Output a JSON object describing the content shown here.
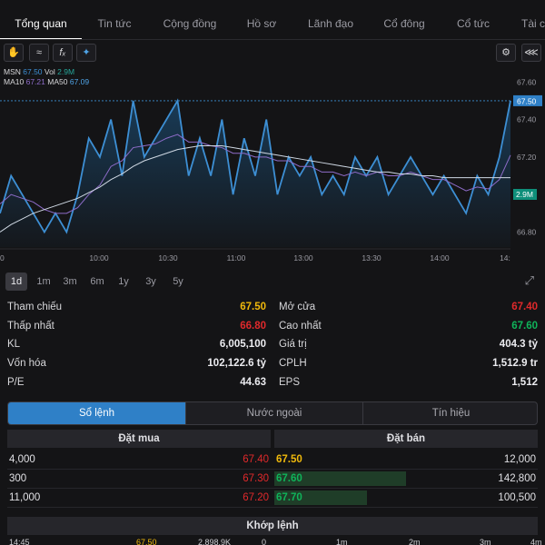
{
  "tabs": [
    "Tổng quan",
    "Tin tức",
    "Cộng đồng",
    "Hồ sơ",
    "Lãnh đạo",
    "Cổ đông",
    "Cổ tức",
    "Tài c"
  ],
  "toolbar": {
    "left_icons": [
      "hand-icon",
      "candle-chart-icon",
      "fx-icon",
      "magic-icon"
    ],
    "right_icons": [
      "gear-icon",
      "share-icon"
    ]
  },
  "legend": {
    "line1": {
      "symbol": "MSN",
      "price": "67.50",
      "vol_label": "Vol",
      "vol": "2.9M"
    },
    "line2": {
      "ma10_label": "MA10",
      "ma10": "67.21",
      "ma50_label": "MA50",
      "ma50": "67.09"
    }
  },
  "chart_data": {
    "type": "line",
    "x": [
      "9:15",
      "9:20",
      "9:25",
      "9:30",
      "9:35",
      "9:40",
      "9:45",
      "9:50",
      "9:55",
      "10:00",
      "10:05",
      "10:10",
      "10:15",
      "10:20",
      "10:25",
      "10:30",
      "10:35",
      "10:40",
      "10:45",
      "10:50",
      "10:55",
      "11:00",
      "11:05",
      "11:10",
      "11:15",
      "11:20",
      "11:25",
      "11:30",
      "13:00",
      "13:05",
      "13:10",
      "13:15",
      "13:20",
      "13:25",
      "13:30",
      "13:35",
      "13:40",
      "13:45",
      "13:50",
      "13:55",
      "14:00",
      "14:05",
      "14:10",
      "14:15",
      "14:20",
      "14:25",
      "14:30"
    ],
    "series": [
      {
        "name": "MSN",
        "values": [
          66.9,
          67.1,
          67.0,
          66.9,
          66.8,
          66.9,
          66.8,
          67.0,
          67.3,
          67.2,
          67.4,
          67.1,
          67.5,
          67.2,
          67.3,
          67.4,
          67.5,
          67.1,
          67.3,
          67.1,
          67.4,
          67.0,
          67.3,
          67.1,
          67.4,
          67.0,
          67.2,
          67.1,
          67.2,
          67.0,
          67.1,
          67.0,
          67.2,
          67.1,
          67.2,
          67.0,
          67.1,
          67.2,
          67.1,
          67.0,
          67.1,
          67.0,
          66.9,
          67.1,
          67.0,
          67.2,
          67.5
        ]
      },
      {
        "name": "MA10",
        "values": [
          66.95,
          67.0,
          66.98,
          66.96,
          66.92,
          66.9,
          66.9,
          66.93,
          67.0,
          67.05,
          67.15,
          67.18,
          67.25,
          67.26,
          67.27,
          67.3,
          67.32,
          67.28,
          67.28,
          67.26,
          67.25,
          67.22,
          67.22,
          67.2,
          67.2,
          67.18,
          67.18,
          67.15,
          67.15,
          67.12,
          67.12,
          67.1,
          67.12,
          67.1,
          67.12,
          67.1,
          67.1,
          67.12,
          67.1,
          67.08,
          67.08,
          67.05,
          67.02,
          67.04,
          67.03,
          67.08,
          67.21
        ]
      },
      {
        "name": "MA50",
        "values": [
          66.8,
          66.84,
          66.87,
          66.9,
          66.92,
          66.94,
          66.96,
          66.98,
          67.01,
          67.04,
          67.08,
          67.11,
          67.15,
          67.18,
          67.2,
          67.22,
          67.24,
          67.25,
          67.26,
          67.26,
          67.26,
          67.25,
          67.24,
          67.23,
          67.22,
          67.21,
          67.2,
          67.19,
          67.18,
          67.17,
          67.16,
          67.15,
          67.14,
          67.13,
          67.12,
          67.12,
          67.11,
          67.11,
          67.1,
          67.1,
          67.09,
          67.09,
          67.09,
          67.09,
          67.09,
          67.09,
          67.09
        ]
      }
    ],
    "x_ticks": [
      "10:00",
      "10:30",
      "11:00",
      "13:00",
      "13:30",
      "14:00",
      "14:"
    ],
    "y_ticks": [
      "67.60",
      "67.40",
      "67.20",
      "67.00",
      "66.80"
    ],
    "ylim": [
      66.72,
      67.64
    ],
    "last_price_label": "67.50",
    "volume_label": "2.9M",
    "grid": false
  },
  "periods": [
    "1d",
    "1m",
    "3m",
    "6m",
    "1y",
    "3y",
    "5y"
  ],
  "stats": {
    "left": [
      {
        "label": "Tham chiếu",
        "value": "67.50",
        "color": "#f0b90b"
      },
      {
        "label": "Thấp nhất",
        "value": "66.80",
        "color": "#e0292b"
      },
      {
        "label": "KL",
        "value": "6,005,100",
        "color": "#ececf0"
      },
      {
        "label": "Vốn hóa",
        "value": "102,122.6 tỷ",
        "color": "#ececf0"
      },
      {
        "label": "P/E",
        "value": "44.63",
        "color": "#ececf0"
      }
    ],
    "right": [
      {
        "label": "Mở cửa",
        "value": "67.40",
        "color": "#e0292b"
      },
      {
        "label": "Cao nhất",
        "value": "67.60",
        "color": "#0fb45a"
      },
      {
        "label": "Giá trị",
        "value": "404.3 tỷ",
        "color": "#ececf0"
      },
      {
        "label": "CPLH",
        "value": "1,512.9 tr",
        "color": "#ececf0"
      },
      {
        "label": "EPS",
        "value": "1,512",
        "color": "#ececf0"
      }
    ]
  },
  "segments": [
    "Sổ lệnh",
    "Nước ngoài",
    "Tín hiệu"
  ],
  "orderbook": {
    "buy_title": "Đặt mua",
    "sell_title": "Đặt bán",
    "rows": [
      {
        "buy_vol": "4,000",
        "buy_price": "67.40",
        "sell_price": "67.50",
        "sell_vol": "12,000",
        "sell_color": "#f0b90b",
        "sell_bar": 0.0
      },
      {
        "buy_vol": "300",
        "buy_price": "67.30",
        "sell_price": "67.60",
        "sell_vol": "142,800",
        "sell_color": "#0fb45a",
        "sell_bar": 1.0
      },
      {
        "buy_vol": "11,000",
        "buy_price": "67.20",
        "sell_price": "67.70",
        "sell_vol": "100,500",
        "sell_color": "#0fb45a",
        "sell_bar": 0.7
      }
    ]
  },
  "matched": {
    "title": "Khớp lệnh",
    "row": {
      "time": "14:45",
      "price": "67.50",
      "volume": "2,898.9K"
    },
    "axis": [
      "0",
      "1m",
      "2m",
      "3m",
      "4m"
    ]
  },
  "colors": {
    "accent": "#2f80c7",
    "line": "#3d8fd4",
    "ma10": "#8e6cc9",
    "ma50": "#cfd8e3"
  }
}
